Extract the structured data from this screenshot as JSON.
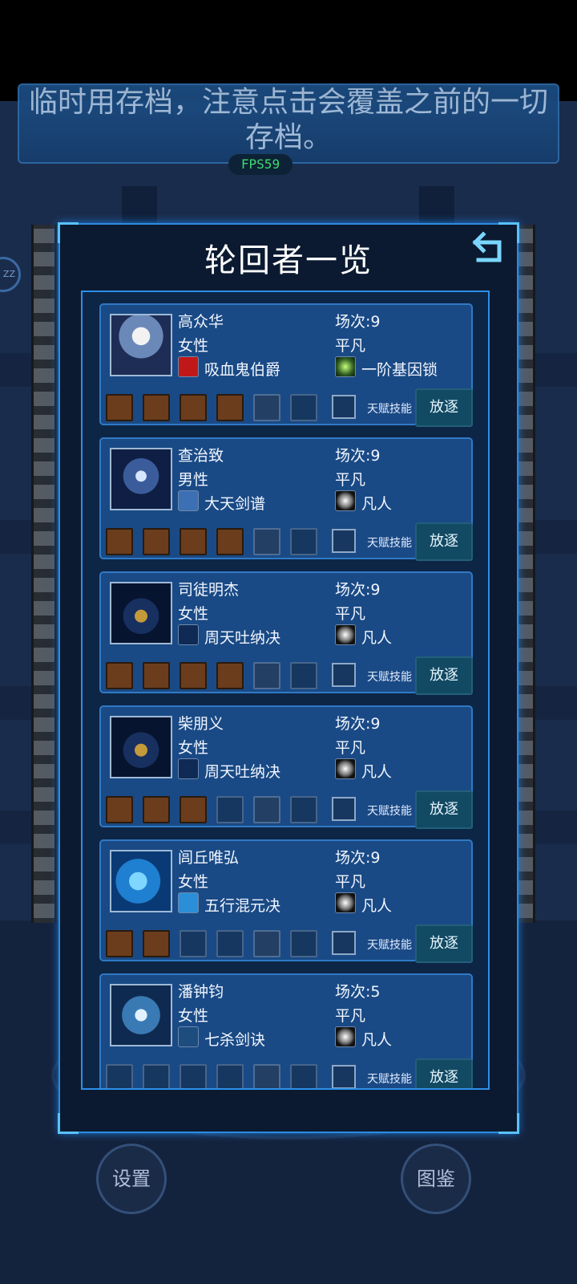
{
  "hint_text": "临时用存档，注意点击会覆盖之前的一切存档。",
  "fps_label": "FPS59",
  "side_badge": "ZZ",
  "modal": {
    "title": "轮回者一览"
  },
  "labels": {
    "talent": "天赋技能",
    "exile": "放逐"
  },
  "bottom_buttons": {
    "settings": "设置",
    "codex": "图鉴"
  },
  "colors": {
    "accent": "#2d8be0",
    "card": "#1a4a85",
    "exile": "#124a63",
    "fps": "#3fd96f"
  },
  "characters": [
    {
      "name": "高众华",
      "gender": "女性",
      "rounds": "场次:9",
      "rank": "平凡",
      "skill": "吸血鬼伯爵",
      "skill_icon": "vampire-eye-icon",
      "gene": "一阶基因锁",
      "gene_icon": "green-spark-icon",
      "slots": [
        "green-pellets-icon",
        "green-potion-icon",
        "armor-icon",
        "canister-icon",
        "pistol-icon",
        "empty"
      ]
    },
    {
      "name": "查治致",
      "gender": "男性",
      "rounds": "场次:9",
      "rank": "平凡",
      "skill": "大天剑谱",
      "skill_icon": "swirl-blade-icon",
      "gene": "凡人",
      "gene_icon": "white-spark-icon",
      "slots": [
        "bracelet-icon",
        "chest-icon",
        "chest-icon",
        "gloves-icon",
        "rifle-icon",
        "empty"
      ]
    },
    {
      "name": "司徒明杰",
      "gender": "女性",
      "rounds": "场次:9",
      "rank": "平凡",
      "skill": "周天吐纳决",
      "skill_icon": "constellation-icon",
      "gene": "凡人",
      "gene_icon": "white-spark-icon",
      "slots": [
        "gloves-icon",
        "chest-icon",
        "shirt-icon",
        "chest-icon",
        "shotgun-icon",
        "empty"
      ]
    },
    {
      "name": "柴朋义",
      "gender": "女性",
      "rounds": "场次:9",
      "rank": "平凡",
      "skill": "周天吐纳决",
      "skill_icon": "constellation-icon",
      "gene": "凡人",
      "gene_icon": "white-spark-icon",
      "slots": [
        "grid-crate-icon",
        "grid-crate-icon",
        "grapple-icon",
        "empty",
        "rifle-icon",
        "empty"
      ]
    },
    {
      "name": "闾丘唯弘",
      "gender": "女性",
      "rounds": "场次:9",
      "rank": "平凡",
      "skill": "五行混元决",
      "skill_icon": "water-orb-icon",
      "gene": "凡人",
      "gene_icon": "white-spark-icon",
      "slots": [
        "grid-crate-icon",
        "grapple-icon",
        "empty",
        "empty",
        "shotgun-icon",
        "empty"
      ]
    },
    {
      "name": "潘钟钧",
      "gender": "女性",
      "rounds": "场次:5",
      "rank": "平凡",
      "skill": "七杀剑诀",
      "skill_icon": "ice-blade-icon",
      "gene": "凡人",
      "gene_icon": "white-spark-icon",
      "slots": [
        "empty",
        "empty",
        "empty",
        "empty",
        "smg-icon",
        "empty"
      ]
    }
  ]
}
